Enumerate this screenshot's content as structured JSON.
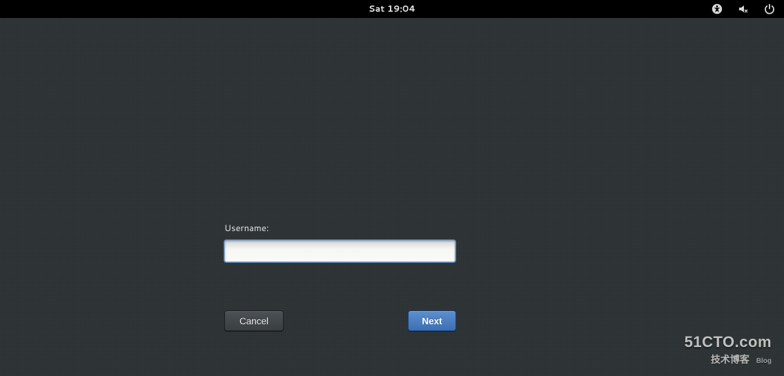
{
  "topbar": {
    "clock": "Sat 19:04",
    "icons": {
      "accessibility": "accessibility-icon",
      "volume": "volume-muted-icon",
      "power": "power-icon"
    }
  },
  "login": {
    "username_label": "Username:",
    "username_value": "",
    "cancel_label": "Cancel",
    "next_label": "Next"
  },
  "watermark": {
    "line1": "51CTO.com",
    "line2_main": "技术博客",
    "line2_tag": "Blog"
  }
}
